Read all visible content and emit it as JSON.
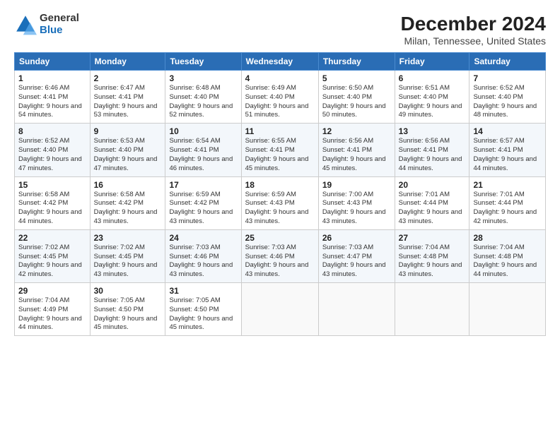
{
  "logo": {
    "general": "General",
    "blue": "Blue"
  },
  "title": "December 2024",
  "subtitle": "Milan, Tennessee, United States",
  "days_of_week": [
    "Sunday",
    "Monday",
    "Tuesday",
    "Wednesday",
    "Thursday",
    "Friday",
    "Saturday"
  ],
  "weeks": [
    [
      {
        "day": "1",
        "sunrise": "Sunrise: 6:46 AM",
        "sunset": "Sunset: 4:41 PM",
        "daylight": "Daylight: 9 hours and 54 minutes."
      },
      {
        "day": "2",
        "sunrise": "Sunrise: 6:47 AM",
        "sunset": "Sunset: 4:41 PM",
        "daylight": "Daylight: 9 hours and 53 minutes."
      },
      {
        "day": "3",
        "sunrise": "Sunrise: 6:48 AM",
        "sunset": "Sunset: 4:40 PM",
        "daylight": "Daylight: 9 hours and 52 minutes."
      },
      {
        "day": "4",
        "sunrise": "Sunrise: 6:49 AM",
        "sunset": "Sunset: 4:40 PM",
        "daylight": "Daylight: 9 hours and 51 minutes."
      },
      {
        "day": "5",
        "sunrise": "Sunrise: 6:50 AM",
        "sunset": "Sunset: 4:40 PM",
        "daylight": "Daylight: 9 hours and 50 minutes."
      },
      {
        "day": "6",
        "sunrise": "Sunrise: 6:51 AM",
        "sunset": "Sunset: 4:40 PM",
        "daylight": "Daylight: 9 hours and 49 minutes."
      },
      {
        "day": "7",
        "sunrise": "Sunrise: 6:52 AM",
        "sunset": "Sunset: 4:40 PM",
        "daylight": "Daylight: 9 hours and 48 minutes."
      }
    ],
    [
      {
        "day": "8",
        "sunrise": "Sunrise: 6:52 AM",
        "sunset": "Sunset: 4:40 PM",
        "daylight": "Daylight: 9 hours and 47 minutes."
      },
      {
        "day": "9",
        "sunrise": "Sunrise: 6:53 AM",
        "sunset": "Sunset: 4:40 PM",
        "daylight": "Daylight: 9 hours and 47 minutes."
      },
      {
        "day": "10",
        "sunrise": "Sunrise: 6:54 AM",
        "sunset": "Sunset: 4:41 PM",
        "daylight": "Daylight: 9 hours and 46 minutes."
      },
      {
        "day": "11",
        "sunrise": "Sunrise: 6:55 AM",
        "sunset": "Sunset: 4:41 PM",
        "daylight": "Daylight: 9 hours and 45 minutes."
      },
      {
        "day": "12",
        "sunrise": "Sunrise: 6:56 AM",
        "sunset": "Sunset: 4:41 PM",
        "daylight": "Daylight: 9 hours and 45 minutes."
      },
      {
        "day": "13",
        "sunrise": "Sunrise: 6:56 AM",
        "sunset": "Sunset: 4:41 PM",
        "daylight": "Daylight: 9 hours and 44 minutes."
      },
      {
        "day": "14",
        "sunrise": "Sunrise: 6:57 AM",
        "sunset": "Sunset: 4:41 PM",
        "daylight": "Daylight: 9 hours and 44 minutes."
      }
    ],
    [
      {
        "day": "15",
        "sunrise": "Sunrise: 6:58 AM",
        "sunset": "Sunset: 4:42 PM",
        "daylight": "Daylight: 9 hours and 44 minutes."
      },
      {
        "day": "16",
        "sunrise": "Sunrise: 6:58 AM",
        "sunset": "Sunset: 4:42 PM",
        "daylight": "Daylight: 9 hours and 43 minutes."
      },
      {
        "day": "17",
        "sunrise": "Sunrise: 6:59 AM",
        "sunset": "Sunset: 4:42 PM",
        "daylight": "Daylight: 9 hours and 43 minutes."
      },
      {
        "day": "18",
        "sunrise": "Sunrise: 6:59 AM",
        "sunset": "Sunset: 4:43 PM",
        "daylight": "Daylight: 9 hours and 43 minutes."
      },
      {
        "day": "19",
        "sunrise": "Sunrise: 7:00 AM",
        "sunset": "Sunset: 4:43 PM",
        "daylight": "Daylight: 9 hours and 43 minutes."
      },
      {
        "day": "20",
        "sunrise": "Sunrise: 7:01 AM",
        "sunset": "Sunset: 4:44 PM",
        "daylight": "Daylight: 9 hours and 43 minutes."
      },
      {
        "day": "21",
        "sunrise": "Sunrise: 7:01 AM",
        "sunset": "Sunset: 4:44 PM",
        "daylight": "Daylight: 9 hours and 42 minutes."
      }
    ],
    [
      {
        "day": "22",
        "sunrise": "Sunrise: 7:02 AM",
        "sunset": "Sunset: 4:45 PM",
        "daylight": "Daylight: 9 hours and 42 minutes."
      },
      {
        "day": "23",
        "sunrise": "Sunrise: 7:02 AM",
        "sunset": "Sunset: 4:45 PM",
        "daylight": "Daylight: 9 hours and 43 minutes."
      },
      {
        "day": "24",
        "sunrise": "Sunrise: 7:03 AM",
        "sunset": "Sunset: 4:46 PM",
        "daylight": "Daylight: 9 hours and 43 minutes."
      },
      {
        "day": "25",
        "sunrise": "Sunrise: 7:03 AM",
        "sunset": "Sunset: 4:46 PM",
        "daylight": "Daylight: 9 hours and 43 minutes."
      },
      {
        "day": "26",
        "sunrise": "Sunrise: 7:03 AM",
        "sunset": "Sunset: 4:47 PM",
        "daylight": "Daylight: 9 hours and 43 minutes."
      },
      {
        "day": "27",
        "sunrise": "Sunrise: 7:04 AM",
        "sunset": "Sunset: 4:48 PM",
        "daylight": "Daylight: 9 hours and 43 minutes."
      },
      {
        "day": "28",
        "sunrise": "Sunrise: 7:04 AM",
        "sunset": "Sunset: 4:48 PM",
        "daylight": "Daylight: 9 hours and 44 minutes."
      }
    ],
    [
      {
        "day": "29",
        "sunrise": "Sunrise: 7:04 AM",
        "sunset": "Sunset: 4:49 PM",
        "daylight": "Daylight: 9 hours and 44 minutes."
      },
      {
        "day": "30",
        "sunrise": "Sunrise: 7:05 AM",
        "sunset": "Sunset: 4:50 PM",
        "daylight": "Daylight: 9 hours and 45 minutes."
      },
      {
        "day": "31",
        "sunrise": "Sunrise: 7:05 AM",
        "sunset": "Sunset: 4:50 PM",
        "daylight": "Daylight: 9 hours and 45 minutes."
      },
      null,
      null,
      null,
      null
    ]
  ],
  "colors": {
    "header_bg": "#2a6db5",
    "accent": "#1a6fba"
  }
}
